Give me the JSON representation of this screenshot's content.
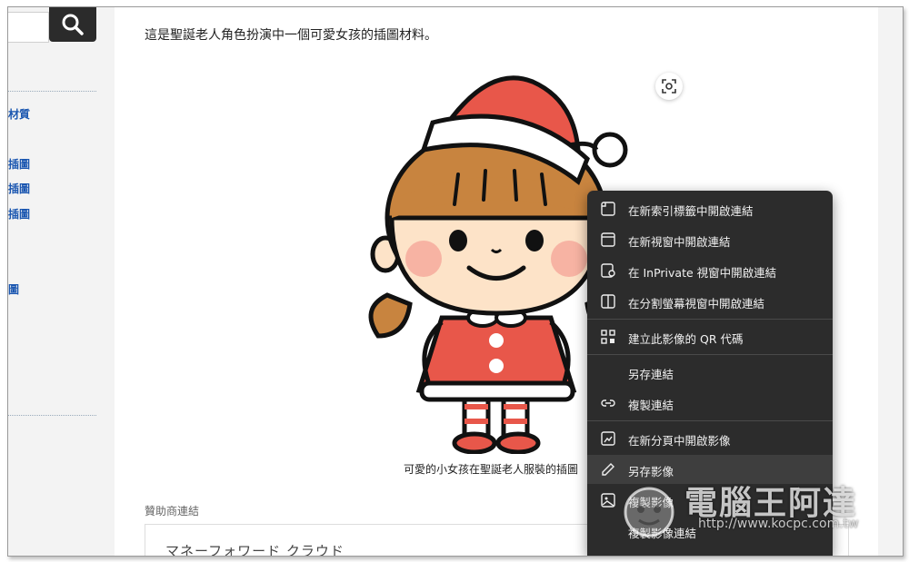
{
  "intro_text": "這是聖誕老人角色扮演中一個可愛女孩的插圖材料。",
  "sidebar": {
    "links": [
      "材質",
      "插圖",
      "插圖",
      "插圖",
      "圖"
    ]
  },
  "caption": "可愛的小女孩在聖誕老人服裝的插圖",
  "sponsor_label": "贊助商連結",
  "ad_text": "マネーフォワード クラウド",
  "context_menu": {
    "items": [
      {
        "label": "在新索引標籤中開啟連結",
        "icon": "new-tab-icon"
      },
      {
        "label": "在新視窗中開啟連結",
        "icon": "new-window-icon"
      },
      {
        "label": "在 InPrivate 視窗中開啟連結",
        "icon": "inprivate-window-icon"
      },
      {
        "label": "在分割螢幕視窗中開啟連結",
        "icon": "split-screen-icon"
      },
      {
        "label": "建立此影像的 QR 代碼",
        "icon": "qr-code-icon"
      },
      {
        "label": "另存連結",
        "icon": ""
      },
      {
        "label": "複製連結",
        "icon": "link-icon"
      },
      {
        "label": "在新分頁中開啟影像",
        "icon": "open-image-icon"
      },
      {
        "label": "另存影像",
        "icon": "save-image-icon"
      },
      {
        "label": "複製影像",
        "icon": "copy-image-icon"
      },
      {
        "label": "複製影像連結",
        "icon": ""
      }
    ]
  },
  "watermark": {
    "title": "電腦王阿達",
    "url": "http://www.kocpc.com.tw"
  },
  "colors": {
    "menu_bg": "#2c2c2c",
    "link_blue": "#1a56b0",
    "santa_red": "#e8574a"
  }
}
